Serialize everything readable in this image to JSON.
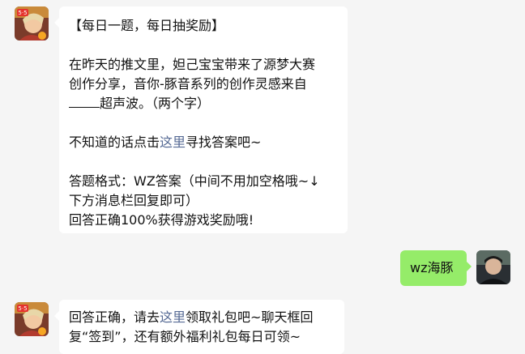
{
  "messages": [
    {
      "sender": "bot",
      "avatar_icon": "hero-avatar-icon",
      "lines": [
        "【每日一题，每日抽奖励】",
        "",
        "在昨天的推文里，妲己宝宝带来了源梦大赛",
        "创作分享，音你-豚音系列的创作灵感来自",
        {
          "before": "",
          "blank": true,
          "after": "超声波。（两个字）"
        },
        "",
        {
          "before": "不知道的话点击",
          "link": "这里",
          "after": "寻找答案吧~"
        },
        "",
        "答题格式：WZ答案（中间不用加空格哦~↓",
        "下方消息栏回复即可）",
        "回答正确100%获得游戏奖励哦!"
      ]
    },
    {
      "sender": "user",
      "avatar_icon": "user-avatar-icon",
      "text": "wz海豚"
    },
    {
      "sender": "bot",
      "avatar_icon": "hero-avatar-icon",
      "lines": [
        {
          "before": "回答正确，请去",
          "link": "这里",
          "after": "领取礼包吧~聊天框回"
        },
        "复“签到”，还有额外福利礼包每日可领~"
      ]
    }
  ],
  "colors": {
    "background": "#f5f5f5",
    "incoming_bubble": "#ffffff",
    "outgoing_bubble": "#95ec69",
    "link": "#576b95"
  }
}
